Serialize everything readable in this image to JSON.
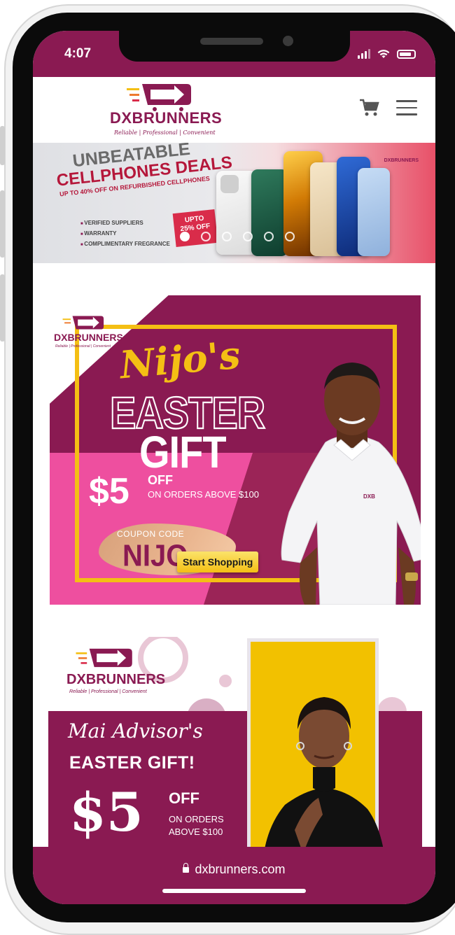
{
  "status_bar": {
    "time": "4:07"
  },
  "header": {
    "logo_text": "DXBRUNNERS",
    "logo_tagline": "Reliable | Professional | Convenient"
  },
  "hero_banner": {
    "line1": "UNBEATABLE",
    "line2": "CELLPHONES DEALS",
    "line3": "UP TO 40% OFF ON REFURBISHED CELLPHONES",
    "bullets": [
      "VERIFIED SUPPLIERS",
      "WARRANTY",
      "COMPLIMENTARY FREGRANCE"
    ],
    "badge_line1": "UPTO",
    "badge_line2": "25% OFF",
    "corner_logo": "DXBRUNNERS",
    "slide_count": 6,
    "active_slide": 1
  },
  "promo_nijo": {
    "logo_text": "DXBRUNNERS",
    "logo_tagline": "Reliable | Professional | Convenient",
    "name": "Nijo's",
    "title": "EASTER",
    "subtitle": "GIFT",
    "amount": "$5",
    "off": "OFF",
    "condition": "ON ORDERS ABOVE $100",
    "coupon_label": "COUPON CODE",
    "coupon_code": "NIJO",
    "cta": "Start Shopping",
    "shirt_logo": "DXB"
  },
  "promo_mai": {
    "logo_text": "DXBRUNNERS",
    "logo_tagline": "Reliable | Professional | Convenient",
    "name": "Mai Advisor's",
    "title": "EASTER GIFT!",
    "amount": "$5",
    "off": "OFF",
    "condition_line1": "ON ORDERS",
    "condition_line2": "ABOVE $100"
  },
  "url_bar": {
    "url": "dxbrunners.com"
  },
  "colors": {
    "brand_maroon": "#8a1a52",
    "accent_yellow": "#f4bf14",
    "accent_pink": "#ee4f9f",
    "hero_red": "#b5173a"
  }
}
